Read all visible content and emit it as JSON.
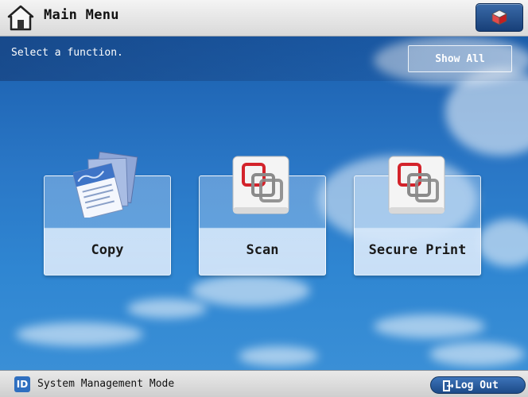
{
  "header": {
    "title": "Main Menu",
    "home_icon": "home-icon",
    "cube_icon": "cube-icon"
  },
  "message": {
    "text": "Select a function."
  },
  "show_all": {
    "label": "Show All"
  },
  "functions": [
    {
      "label": "Copy",
      "icon": "copy-documents-icon"
    },
    {
      "label": "Scan",
      "icon": "scan-overlap-icon"
    },
    {
      "label": "Secure Print",
      "icon": "secure-print-overlap-icon"
    }
  ],
  "footer": {
    "id_badge": "ID",
    "status": "System Management Mode",
    "logout_label": "Log Out"
  },
  "colors": {
    "sky": "#2a77c6",
    "button_blue": "#1c4a88",
    "icon_red": "#d3232b"
  }
}
